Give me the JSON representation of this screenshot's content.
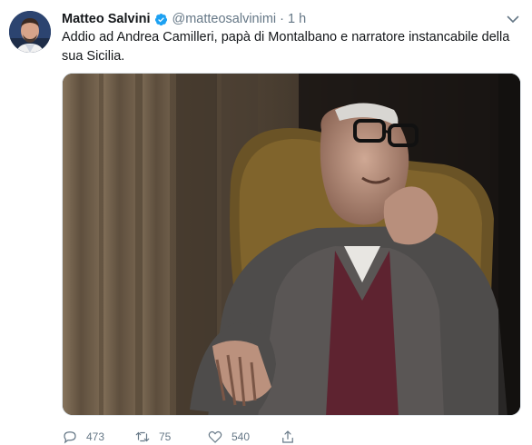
{
  "tweet": {
    "author_name": "Matteo Salvini",
    "handle": "@matteosalvinimi",
    "separator": "·",
    "time": "1 h",
    "text": "Addio ad Andrea Camilleri, papà di Montalbano e narratore instancabile della sua Sicilia."
  },
  "actions": {
    "replies": "473",
    "retweets": "75",
    "likes": "540"
  },
  "icons": {
    "verified": "verified-badge-icon",
    "caret": "chevron-down-icon",
    "reply": "reply-icon",
    "retweet": "retweet-icon",
    "like": "heart-icon",
    "share": "share-icon"
  },
  "colors": {
    "text": "#14171a",
    "secondary": "#657786",
    "verified": "#1da1f2",
    "border": "#e1e8ed"
  }
}
